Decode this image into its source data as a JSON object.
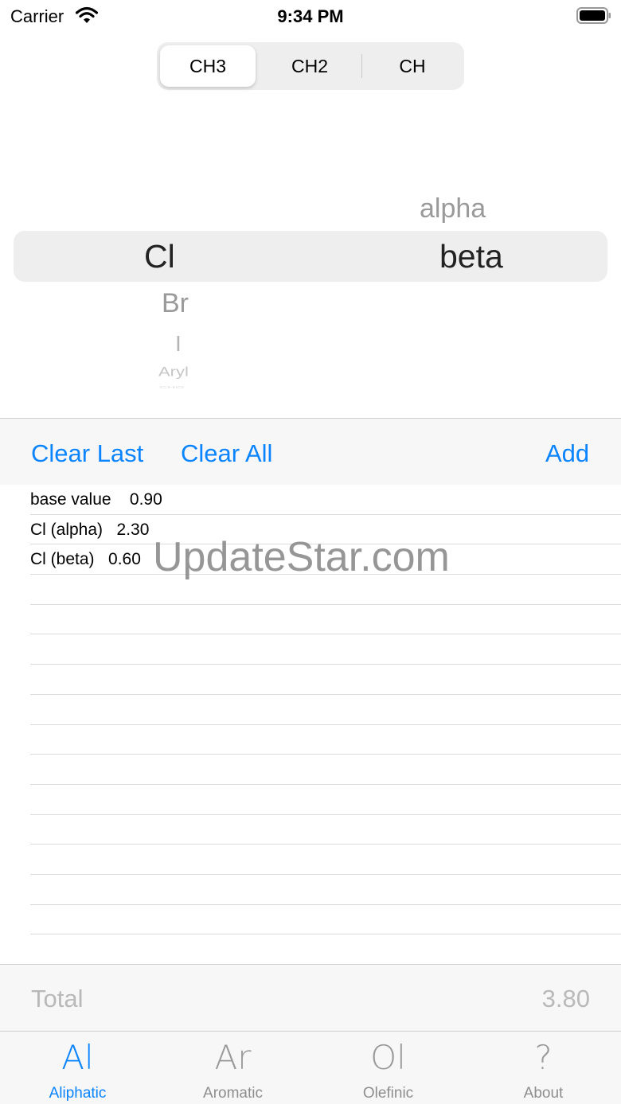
{
  "status_bar": {
    "carrier": "Carrier",
    "time": "9:34 PM"
  },
  "segmented_control": {
    "items": [
      "CH3",
      "CH2",
      "CH"
    ],
    "selected": "CH3"
  },
  "picker": {
    "left_column": {
      "selected": "Cl",
      "below": [
        "Br",
        "I",
        "Aryl",
        "CHO"
      ]
    },
    "right_column": {
      "above": [
        "alpha"
      ],
      "selected": "beta"
    }
  },
  "toolbar": {
    "clear_last": "Clear Last",
    "clear_all": "Clear All",
    "add": "Add"
  },
  "list": {
    "rows": [
      "base value    0.90",
      "Cl (alpha)   2.30",
      "Cl (beta)   0.60"
    ],
    "empty_rows": 13
  },
  "watermark": "UpdateStar.com",
  "total": {
    "label": "Total",
    "value": "3.80"
  },
  "tab_bar": {
    "active": "Aliphatic",
    "tabs": [
      {
        "icon": "Al",
        "label": "Aliphatic"
      },
      {
        "icon": "Ar",
        "label": "Aromatic"
      },
      {
        "icon": "Ol",
        "label": "Olefinic"
      },
      {
        "icon": "?",
        "label": "About"
      }
    ]
  },
  "colors": {
    "accent": "#0a84ff",
    "inactive": "#8e8e8e",
    "bar_background": "#f7f7f7"
  }
}
